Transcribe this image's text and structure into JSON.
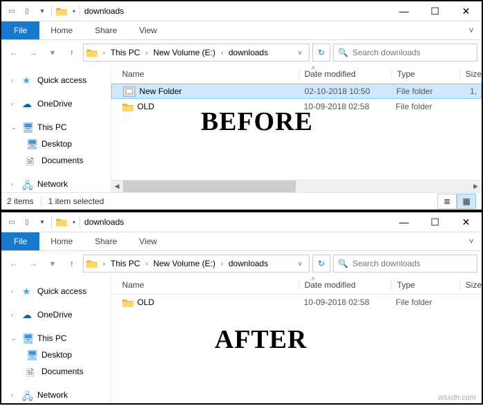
{
  "watermark": "wsxdn.com",
  "before": {
    "label": "BEFORE",
    "title": "downloads",
    "ribbon": {
      "file": "File",
      "home": "Home",
      "share": "Share",
      "view": "View"
    },
    "breadcrumb": {
      "root": "This PC",
      "vol": "New Volume (E:)",
      "folder": "downloads"
    },
    "search_placeholder": "Search downloads",
    "sidebar": {
      "quick_access": "Quick access",
      "onedrive": "OneDrive",
      "this_pc": "This PC",
      "desktop": "Desktop",
      "documents": "Documents",
      "network": "Network"
    },
    "columns": {
      "name": "Name",
      "date": "Date modified",
      "type": "Type",
      "size": "Size"
    },
    "rows": [
      {
        "name": "New Folder",
        "date": "02-10-2018 10:50",
        "type": "File folder",
        "size": "1,",
        "selected": true,
        "renaming": true
      },
      {
        "name": "OLD",
        "date": "10-09-2018 02:58",
        "type": "File folder",
        "size": "",
        "selected": false,
        "renaming": false
      }
    ],
    "status": {
      "items": "2 items",
      "selected": "1 item selected"
    }
  },
  "after": {
    "label": "AFTER",
    "title": "downloads",
    "ribbon": {
      "file": "File",
      "home": "Home",
      "share": "Share",
      "view": "View"
    },
    "breadcrumb": {
      "root": "This PC",
      "vol": "New Volume (E:)",
      "folder": "downloads"
    },
    "search_placeholder": "Search downloads",
    "sidebar": {
      "quick_access": "Quick access",
      "onedrive": "OneDrive",
      "this_pc": "This PC",
      "desktop": "Desktop",
      "documents": "Documents",
      "network": "Network"
    },
    "columns": {
      "name": "Name",
      "date": "Date modified",
      "type": "Type",
      "size": "Size"
    },
    "rows": [
      {
        "name": "OLD",
        "date": "10-09-2018 02:58",
        "type": "File folder",
        "size": "",
        "selected": false,
        "renaming": false
      }
    ]
  }
}
